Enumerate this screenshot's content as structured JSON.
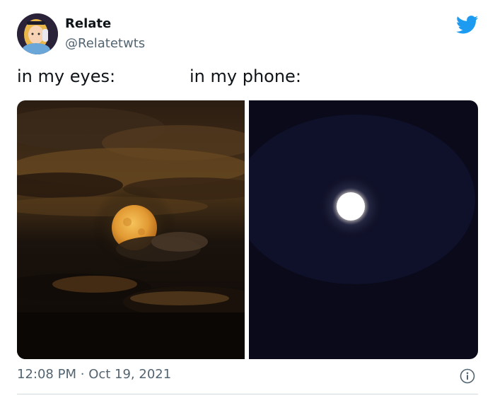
{
  "author": {
    "name": "Relate",
    "handle": "@Relatetwts",
    "avatar_icon": "cartoon-girl-avatar"
  },
  "tweet": {
    "text_left": "in my eyes:",
    "text_right": "in my phone:"
  },
  "media": {
    "left_image": "orange-full-moon-among-clouds",
    "right_image": "small-white-moon-dark-sky"
  },
  "footer": {
    "time": "12:08 PM",
    "separator": "·",
    "date": "Oct 19, 2021",
    "info_icon": "info-icon"
  },
  "colors": {
    "brand": "#1d9bf0",
    "text": "#0f1419",
    "secondary_text": "#536471"
  }
}
